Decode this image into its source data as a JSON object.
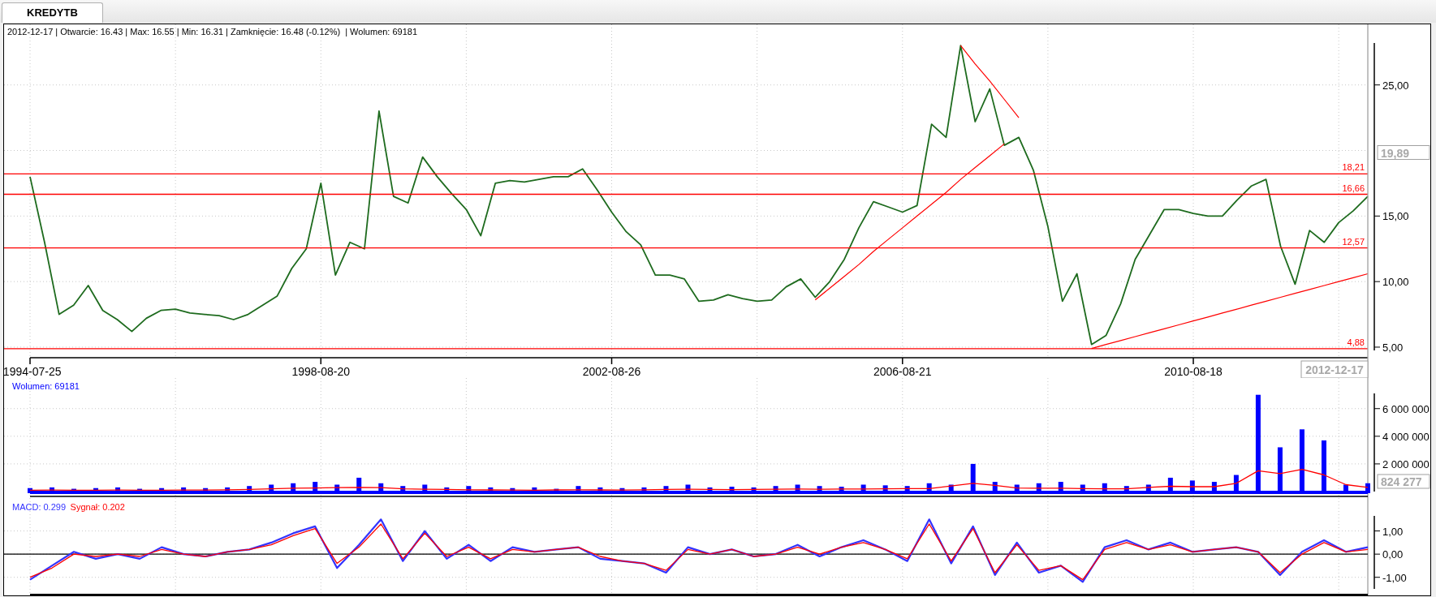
{
  "tab": {
    "label": "KREDYTB",
    "selected": true
  },
  "price_panel": {
    "header": "2012-12-17 | Otwarcie: 16.43 | Max: 16.55 | Min: 16.31 | Zamknięcie: 16.48 (-0.12%)  | Wolumen: 69181",
    "chart_data": {
      "type": "line",
      "grid": true,
      "ylim": [
        4.75,
        28.2
      ],
      "yticks": [
        {
          "value": 5,
          "label": "5,00"
        },
        {
          "value": 10,
          "label": "10,00"
        },
        {
          "value": 15,
          "label": "15,00"
        },
        {
          "value": 25,
          "label": "25,00"
        }
      ],
      "categories": [
        "1994-07-25",
        null,
        null,
        null,
        null,
        null,
        null,
        null,
        null,
        null,
        null,
        null,
        null,
        null,
        null,
        null,
        null,
        null,
        null,
        null,
        "1998-08-20",
        null,
        null,
        null,
        null,
        null,
        null,
        null,
        null,
        null,
        null,
        null,
        null,
        null,
        null,
        null,
        null,
        null,
        null,
        null,
        "2002-08-26",
        null,
        null,
        null,
        null,
        null,
        null,
        null,
        null,
        null,
        null,
        null,
        null,
        null,
        null,
        null,
        null,
        null,
        null,
        null,
        "2006-08-21",
        null,
        null,
        null,
        null,
        null,
        null,
        null,
        null,
        null,
        null,
        null,
        null,
        null,
        null,
        null,
        null,
        null,
        null,
        null,
        "2010-08-18",
        null,
        null,
        null,
        null,
        null,
        null,
        null,
        null,
        null,
        null,
        null,
        null
      ],
      "series": [
        {
          "color": "#1e6b1e",
          "values": [
            18,
            13,
            7.5,
            8.2,
            9.7,
            7.8,
            7.1,
            6.2,
            7.2,
            7.8,
            7.9,
            7.6,
            7.5,
            7.4,
            7.1,
            7.5,
            8.2,
            8.9,
            11,
            12.5,
            17.5,
            10.5,
            13,
            12.5,
            23,
            16.5,
            16,
            19.5,
            18,
            16.7,
            15.5,
            13.5,
            17.5,
            17.7,
            17.6,
            17.8,
            18,
            18,
            18.6,
            17,
            15.3,
            13.8,
            12.8,
            10.5,
            10.5,
            10.2,
            8.5,
            8.6,
            9,
            8.7,
            8.5,
            8.6,
            9.6,
            10.2,
            8.8,
            10,
            11.7,
            14.1,
            16.1,
            15.7,
            15.3,
            15.8,
            22,
            21,
            28,
            22.2,
            24.7,
            20.4,
            21,
            18.5,
            14.2,
            8.5,
            10.6,
            5.2,
            5.9,
            8.3,
            11.7,
            13.6,
            15.5,
            15.5,
            15.2,
            15,
            15,
            16.2,
            17.3,
            17.8,
            12.7,
            9.8,
            13.9,
            13,
            14.5,
            15.4,
            16.5
          ]
        },
        {
          "color": "#ff0000",
          "values": [
            null,
            null,
            null,
            null,
            null,
            null,
            null,
            null,
            null,
            null,
            null,
            null,
            null,
            null,
            null,
            null,
            null,
            null,
            null,
            null,
            null,
            null,
            null,
            null,
            null,
            null,
            null,
            null,
            null,
            null,
            null,
            null,
            null,
            null,
            null,
            null,
            null,
            null,
            null,
            null,
            null,
            null,
            null,
            null,
            null,
            null,
            null,
            null,
            null,
            null,
            null,
            null,
            null,
            null,
            8.6,
            9.5,
            10.4,
            11.3,
            12.3,
            13.2,
            14.1,
            15.0,
            15.9,
            16.8,
            17.8,
            18.7,
            19.6,
            20.5,
            null,
            null,
            null,
            null,
            null,
            null,
            null,
            null,
            null,
            null,
            null,
            null,
            null,
            null,
            null,
            null,
            null,
            null,
            null,
            null,
            null,
            null,
            null,
            null,
            null
          ]
        },
        {
          "color": "#ff0000",
          "values": [
            null,
            null,
            null,
            null,
            null,
            null,
            null,
            null,
            null,
            null,
            null,
            null,
            null,
            null,
            null,
            null,
            null,
            null,
            null,
            null,
            null,
            null,
            null,
            null,
            null,
            null,
            null,
            null,
            null,
            null,
            null,
            null,
            null,
            null,
            null,
            null,
            null,
            null,
            null,
            null,
            null,
            null,
            null,
            null,
            null,
            null,
            null,
            null,
            null,
            null,
            null,
            null,
            null,
            null,
            null,
            null,
            null,
            null,
            null,
            null,
            null,
            null,
            null,
            null,
            28,
            26.6,
            25.3,
            23.9,
            22.5,
            null,
            null,
            null,
            null,
            null,
            null,
            null,
            null,
            null,
            null,
            null,
            null,
            null,
            null,
            null,
            null,
            null,
            null,
            null,
            null,
            null,
            null,
            null,
            null
          ]
        },
        {
          "color": "#ff0000",
          "values": [
            null,
            null,
            null,
            null,
            null,
            null,
            null,
            null,
            null,
            null,
            null,
            null,
            null,
            null,
            null,
            null,
            null,
            null,
            null,
            null,
            null,
            null,
            null,
            null,
            null,
            null,
            null,
            null,
            null,
            null,
            null,
            null,
            null,
            null,
            null,
            null,
            null,
            null,
            null,
            null,
            null,
            null,
            null,
            null,
            null,
            null,
            null,
            null,
            null,
            null,
            null,
            null,
            null,
            null,
            null,
            null,
            null,
            null,
            null,
            null,
            null,
            null,
            null,
            null,
            null,
            null,
            null,
            null,
            null,
            null,
            null,
            null,
            null,
            4.9,
            5.2,
            5.5,
            5.8,
            6.1,
            6.4,
            6.7,
            7.0,
            7.3,
            7.6,
            7.9,
            8.2,
            8.5,
            8.8,
            9.1,
            9.4,
            9.7,
            10.0,
            10.3,
            10.6
          ]
        }
      ],
      "ref_lines": [
        {
          "axis": "y",
          "value": 18.21,
          "label": "18,21"
        },
        {
          "axis": "y",
          "value": 16.66,
          "label": "16,66"
        },
        {
          "axis": "y",
          "value": 12.57,
          "label": "12,57"
        },
        {
          "axis": "y",
          "value": 4.88,
          "label": "4,88"
        }
      ]
    },
    "cursor_value": "19,89",
    "cursor_date": "2012-12-17"
  },
  "volume_panel": {
    "label": "Wolumen: 69181",
    "chart_data": {
      "type": "bar",
      "grid": true,
      "ylim": [
        0,
        7100000
      ],
      "yticks": [
        {
          "value": 2000000,
          "label": "2 000 000"
        },
        {
          "value": 4000000,
          "label": "4 000 000"
        },
        {
          "value": 6000000,
          "label": "6 000 000"
        }
      ],
      "categories": [
        null,
        null,
        null,
        null,
        null,
        null,
        null,
        null,
        null,
        null,
        null,
        null,
        null,
        null,
        null,
        null,
        null,
        null,
        null,
        null,
        null,
        null,
        null,
        null,
        null,
        null,
        null,
        null,
        null,
        null,
        null,
        null,
        null,
        null,
        null,
        null,
        null,
        null,
        null,
        null,
        null,
        null,
        null,
        null,
        null,
        null,
        null,
        null,
        null,
        null,
        null,
        null,
        null,
        null,
        null,
        null,
        null,
        null,
        null,
        null,
        null,
        null
      ],
      "series": [
        {
          "type": "bar",
          "color": "#0000ff",
          "values": [
            250000,
            300000,
            200000,
            250000,
            300000,
            200000,
            250000,
            300000,
            250000,
            300000,
            400000,
            500000,
            600000,
            700000,
            500000,
            1000000,
            600000,
            400000,
            500000,
            300000,
            400000,
            300000,
            250000,
            300000,
            200000,
            400000,
            300000,
            250000,
            300000,
            400000,
            500000,
            300000,
            350000,
            300000,
            400000,
            500000,
            400000,
            350000,
            500000,
            450000,
            400000,
            600000,
            500000,
            2000000,
            700000,
            500000,
            600000,
            700000,
            500000,
            600000,
            400000,
            500000,
            1000000,
            800000,
            700000,
            1200000,
            7000000,
            3200000,
            4500000,
            3700000,
            500000,
            600000
          ]
        },
        {
          "type": "line",
          "color": "#ff0000",
          "values": [
            100000,
            110000,
            100000,
            100000,
            110000,
            100000,
            100000,
            110000,
            110000,
            130000,
            160000,
            200000,
            240000,
            260000,
            280000,
            300000,
            280000,
            200000,
            170000,
            150000,
            130000,
            120000,
            110000,
            100000,
            120000,
            130000,
            120000,
            110000,
            130000,
            160000,
            170000,
            150000,
            140000,
            150000,
            170000,
            180000,
            170000,
            180000,
            190000,
            200000,
            210000,
            220000,
            400000,
            600000,
            450000,
            260000,
            240000,
            240000,
            220000,
            200000,
            200000,
            300000,
            380000,
            350000,
            350000,
            600000,
            1500000,
            1300000,
            1600000,
            1200000,
            500000,
            300000
          ]
        }
      ]
    },
    "cursor_value": "824 277"
  },
  "macd_panel": {
    "legend": [
      "MACD: 0.299",
      "Sygnał: 0.202"
    ],
    "chart_data": {
      "type": "line",
      "grid": true,
      "ylim": [
        -1.5,
        1.65
      ],
      "yticks": [
        {
          "value": -1,
          "label": "-1,00"
        },
        {
          "value": 0,
          "label": "0,00"
        },
        {
          "value": 1,
          "label": "1,00"
        }
      ],
      "categories": [
        null,
        null,
        null,
        null,
        null,
        null,
        null,
        null,
        null,
        null,
        null,
        null,
        null,
        null,
        null,
        null,
        null,
        null,
        null,
        null,
        null,
        null,
        null,
        null,
        null,
        null,
        null,
        null,
        null,
        null,
        null,
        null,
        null,
        null,
        null,
        null,
        null,
        null,
        null,
        null,
        null,
        null,
        null,
        null,
        null,
        null,
        null,
        null,
        null,
        null,
        null,
        null,
        null,
        null,
        null,
        null,
        null,
        null,
        null,
        null,
        null,
        null
      ],
      "series": [
        {
          "color": "#3333ff",
          "values": [
            -1.1,
            -0.5,
            0.1,
            -0.2,
            0.0,
            -0.2,
            0.3,
            0.0,
            -0.1,
            0.1,
            0.2,
            0.5,
            0.9,
            1.2,
            -0.6,
            0.4,
            1.5,
            -0.3,
            1.0,
            -0.2,
            0.4,
            -0.3,
            0.3,
            0.1,
            0.2,
            0.3,
            -0.2,
            -0.3,
            -0.4,
            -0.8,
            0.3,
            0.0,
            0.2,
            -0.1,
            0.0,
            0.4,
            -0.1,
            0.3,
            0.6,
            0.2,
            -0.3,
            1.5,
            -0.4,
            1.2,
            -0.9,
            0.5,
            -0.8,
            -0.5,
            -1.2,
            0.3,
            0.6,
            0.2,
            0.5,
            0.1,
            0.2,
            0.3,
            0.1,
            -0.9,
            0.1,
            0.6,
            0.1,
            0.3
          ]
        },
        {
          "color": "#ff0000",
          "values": [
            -1.0,
            -0.6,
            0.0,
            -0.1,
            0.0,
            -0.1,
            0.2,
            0.0,
            -0.1,
            0.1,
            0.2,
            0.4,
            0.8,
            1.1,
            -0.4,
            0.3,
            1.3,
            -0.2,
            0.9,
            -0.1,
            0.3,
            -0.2,
            0.2,
            0.1,
            0.2,
            0.3,
            -0.1,
            -0.3,
            -0.4,
            -0.7,
            0.2,
            0.0,
            0.2,
            -0.1,
            0.0,
            0.3,
            0.0,
            0.3,
            0.5,
            0.2,
            -0.2,
            1.3,
            -0.3,
            1.1,
            -0.8,
            0.4,
            -0.7,
            -0.5,
            -1.1,
            0.2,
            0.5,
            0.2,
            0.4,
            0.1,
            0.2,
            0.3,
            0.1,
            -0.8,
            0.0,
            0.5,
            0.1,
            0.2
          ]
        }
      ]
    }
  }
}
